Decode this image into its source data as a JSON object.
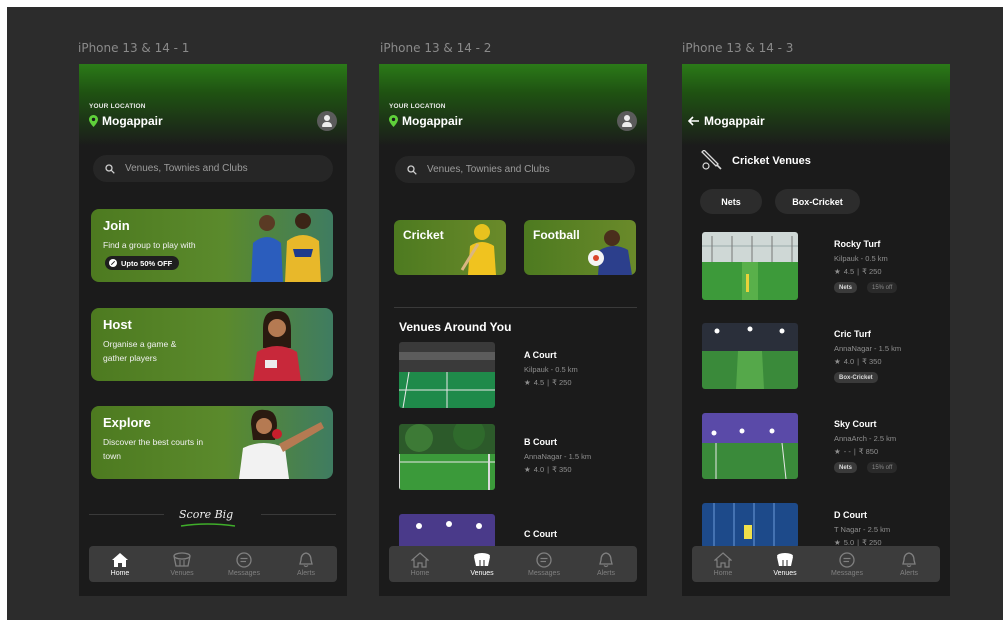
{
  "frames": [
    "iPhone 13 & 14 - 1",
    "iPhone 13 & 14 - 2",
    "iPhone 13 & 14 - 3"
  ],
  "location": {
    "caption": "YOUR LOCATION",
    "name": "Mogappair"
  },
  "search": {
    "placeholder": "Venues, Townies and  Clubs"
  },
  "home": {
    "cards": [
      {
        "title": "Join",
        "subtitle": "Find a group to play with",
        "badge": "Upto 50% OFF"
      },
      {
        "title": "Host",
        "subtitle": "Organise a game & gather players"
      },
      {
        "title": "Explore",
        "subtitle": "Discover the best courts in town"
      }
    ],
    "score": "Score Big"
  },
  "venues_screen": {
    "sports": [
      "Cricket",
      "Football"
    ],
    "section_title": "Venues Around You",
    "venues": [
      {
        "name": "A Court",
        "distance": "Kilpauk - 0.5 km",
        "rating": "4.5",
        "price": "₹ 250"
      },
      {
        "name": "B Court",
        "distance": "AnnaNagar - 1.5 km",
        "rating": "4.0",
        "price": "₹ 350"
      },
      {
        "name": "C Court"
      }
    ]
  },
  "cricket_screen": {
    "back_title": "Mogappair",
    "title": "Cricket Venues",
    "chips": [
      "Nets",
      "Box-Cricket"
    ],
    "venues": [
      {
        "name": "Rocky Turf",
        "distance": "Kilpauk - 0.5 km",
        "rating": "4.5",
        "price": "₹ 250",
        "tags": [
          "Nets"
        ],
        "offer": "15% off"
      },
      {
        "name": "Cric Turf",
        "distance": "AnnaNagar - 1.5 km",
        "rating": "4.0",
        "price": "₹ 350",
        "tags": [
          "Box-Cricket"
        ],
        "offer": ""
      },
      {
        "name": "Sky Court",
        "distance": "AnnaArch - 2.5 km",
        "rating": "- -",
        "price": "₹ 850",
        "tags": [
          "Nets"
        ],
        "offer": "15% off"
      },
      {
        "name": "D Court",
        "distance": "T Nagar - 2.5 km",
        "rating": "5.0",
        "price": "₹ 250"
      }
    ]
  },
  "nav": [
    "Home",
    "Venues",
    "Messages",
    "Alerts"
  ],
  "colors": {
    "accent_green": "#2b7a18",
    "card_green": "#5b8a2c",
    "background": "#1b1b1b"
  }
}
